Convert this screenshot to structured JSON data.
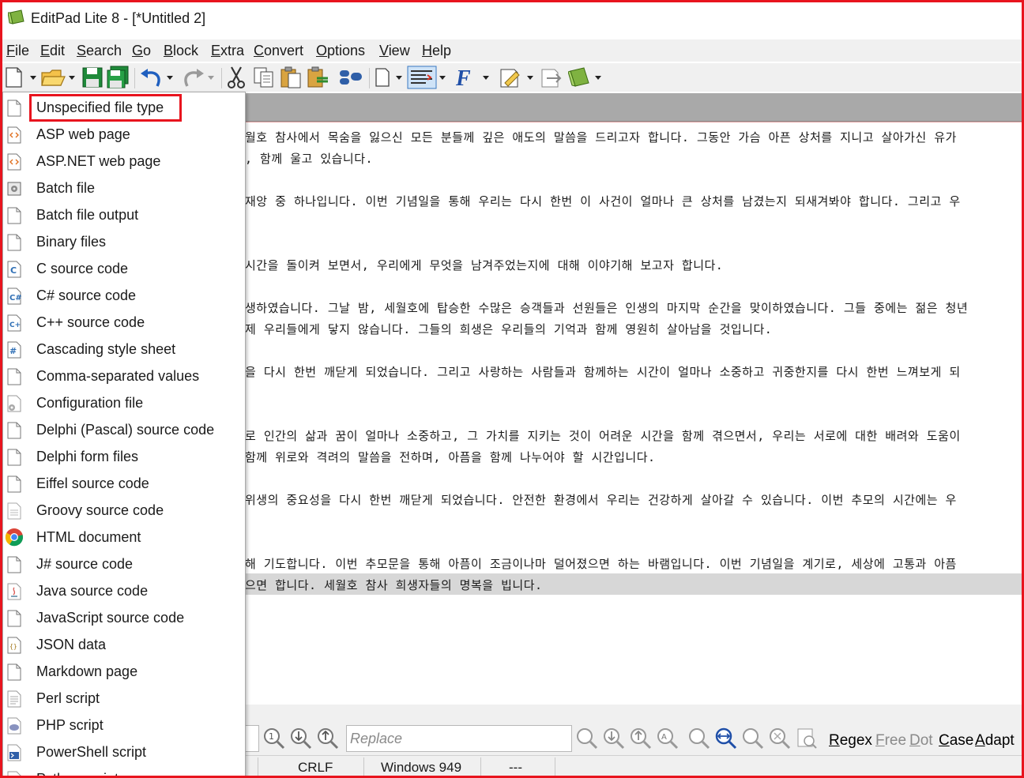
{
  "window": {
    "title": "EditPad Lite 8 - [*Untitled 2]"
  },
  "menu": [
    {
      "label": "File",
      "u": "F",
      "rest": "ile"
    },
    {
      "label": "Edit",
      "u": "E",
      "rest": "dit"
    },
    {
      "label": "Search",
      "u": "S",
      "rest": "earch"
    },
    {
      "label": "Go",
      "u": "G",
      "rest": "o"
    },
    {
      "label": "Block",
      "u": "B",
      "rest": "lock"
    },
    {
      "label": "Extra",
      "u": "E",
      "rest": "xtra"
    },
    {
      "label": "Convert",
      "u": "C",
      "rest": "onvert"
    },
    {
      "label": "Options",
      "u": "O",
      "rest": "ptions"
    },
    {
      "label": "View",
      "u": "V",
      "rest": "iew"
    },
    {
      "label": "Help",
      "u": "H",
      "rest": "elp"
    }
  ],
  "toolbar": {
    "icons": [
      "new-file-icon",
      "open-folder-icon",
      "save-icon",
      "save-all-icon",
      "undo-icon",
      "redo-icon",
      "cut-icon",
      "copy-icon",
      "paste-icon",
      "clipboard-icon",
      "macro-icon",
      "file-type-icon",
      "word-wrap-icon",
      "font-icon",
      "edit-note-icon",
      "export-icon",
      "spellcheck-book-icon"
    ]
  },
  "file_type_menu": {
    "items": [
      {
        "label": "Unspecified file type",
        "icon": "blank-file-icon"
      },
      {
        "label": "ASP web page",
        "icon": "asp-file-icon"
      },
      {
        "label": "ASP.NET web page",
        "icon": "aspnet-file-icon"
      },
      {
        "label": "Batch file",
        "icon": "batch-file-icon"
      },
      {
        "label": "Batch file output",
        "icon": "blank-file-icon"
      },
      {
        "label": "Binary files",
        "icon": "blank-file-icon"
      },
      {
        "label": "C source code",
        "icon": "c-file-icon"
      },
      {
        "label": "C# source code",
        "icon": "csharp-file-icon"
      },
      {
        "label": "C++ source code",
        "icon": "cpp-file-icon"
      },
      {
        "label": "Cascading style sheet",
        "icon": "css-file-icon"
      },
      {
        "label": "Comma-separated values",
        "icon": "blank-file-icon"
      },
      {
        "label": "Configuration file",
        "icon": "config-file-icon"
      },
      {
        "label": "Delphi (Pascal) source code",
        "icon": "blank-file-icon"
      },
      {
        "label": "Delphi form files",
        "icon": "blank-file-icon"
      },
      {
        "label": "Eiffel source code",
        "icon": "blank-file-icon"
      },
      {
        "label": "Groovy source code",
        "icon": "blank-file-icon"
      },
      {
        "label": "HTML document",
        "icon": "chrome-icon"
      },
      {
        "label": "J# source code",
        "icon": "blank-file-icon"
      },
      {
        "label": "Java source code",
        "icon": "java-file-icon"
      },
      {
        "label": "JavaScript source code",
        "icon": "blank-file-icon"
      },
      {
        "label": "JSON data",
        "icon": "json-file-icon"
      },
      {
        "label": "Markdown page",
        "icon": "blank-file-icon"
      },
      {
        "label": "Perl script",
        "icon": "perl-file-icon"
      },
      {
        "label": "PHP script",
        "icon": "php-file-icon"
      },
      {
        "label": "PowerShell script",
        "icon": "powershell-file-icon"
      },
      {
        "label": "Python script",
        "icon": "python-file-icon"
      }
    ]
  },
  "editor": {
    "lines": [
      {
        "text": "월호 참사에서 목숨을 잃으신 모든 분들께 깊은 애도의 말씀을 드리고자 합니다. 그동안 가슴 아픈 상처를 지니고 살아가신 유가"
      },
      {
        "text": ", 함께 울고 있습니다."
      },
      {
        "text": "재앙 중 하나입니다. 이번 기념일을 통해 우리는 다시 한번 이 사건이 얼마나 큰 상처를 남겼는지 되새겨봐야 합니다. 그리고 우"
      },
      {
        "text": "시간을 돌이켜 보면서, 우리에게 무엇을 남겨주었는지에 대해 이야기해 보고자 합니다."
      },
      {
        "text": "생하였습니다. 그날 밤, 세월호에 탑승한 수많은 승객들과 선원들은 인생의 마지막 순간을 맞이하였습니다. 그들 중에는 젊은 청년"
      },
      {
        "text": "제 우리들에게 닿지 않습니다. 그들의 희생은 우리들의 기억과 함께 영원히 살아남을 것입니다."
      },
      {
        "text": "을 다시 한번 깨닫게 되었습니다. 그리고 사랑하는 사람들과 함께하는 시간이 얼마나 소중하고 귀중한지를 다시 한번 느껴보게 되"
      },
      {
        "text": "로 인간의 삶과 꿈이 얼마나 소중하고, 그 가치를 지키는 것이 어려운 시간을 함께 겪으면서, 우리는 서로에 대한 배려와 도움이"
      },
      {
        "text": " 함께 위로와 격려의 말씀을 전하며, 아픔을 함께 나누어야 할 시간입니다."
      },
      {
        "text": " 위생의 중요성을 다시 한번 깨닫게 되었습니다. 안전한 환경에서 우리는 건강하게 살아갈 수 있습니다. 이번 추모의 시간에는 우"
      },
      {
        "text": "해 기도합니다. 이번 추모문을 통해 아픔이 조금이나마 덜어졌으면 하는 바램입니다. 이번 기념일을 계기로, 세상에 고통과 아픔"
      },
      {
        "text": "으면 합니다. 세월호 참사 희생자들의 명복을 빕니다."
      }
    ]
  },
  "findbar": {
    "replace_placeholder": "Replace",
    "options": [
      {
        "label": "Regex",
        "u": "R",
        "rest": "egex",
        "enabled": true
      },
      {
        "label": "Free",
        "u": "F",
        "rest": "ree",
        "enabled": false
      },
      {
        "label": "Dot",
        "u": "D",
        "rest": "ot",
        "enabled": false
      },
      {
        "label": "Case",
        "u": "C",
        "rest": "ase",
        "enabled": true
      },
      {
        "label": "Adapt",
        "u": "A",
        "rest": "dapt",
        "enabled": true
      }
    ]
  },
  "statusbar": {
    "line_ending": "CRLF",
    "encoding": "Windows 949",
    "extra": "---"
  },
  "colors": {
    "highlight_border": "#e8141e",
    "tab_strip": "#a9a9a9",
    "current_line": "#d7d7d7"
  }
}
